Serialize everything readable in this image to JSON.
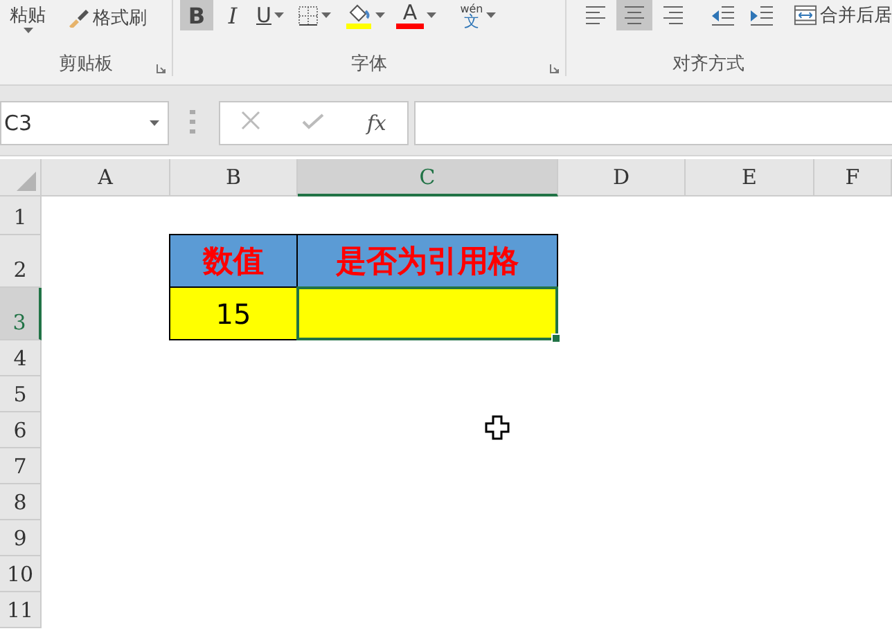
{
  "ribbon": {
    "groups": [
      {
        "label": "剪贴板",
        "launcher": true,
        "paste": {
          "label": "粘贴"
        },
        "format_painter": {
          "label": "格式刷"
        }
      },
      {
        "label": "字体",
        "launcher": true,
        "buttons": [
          {
            "kind": "bold",
            "text": "B",
            "selected": true
          },
          {
            "kind": "italic",
            "text": "I",
            "selected": false
          },
          {
            "kind": "underline",
            "text": "U",
            "selected": false,
            "dropdown": true
          },
          {
            "kind": "borders",
            "selected": false,
            "dropdown": true
          },
          {
            "kind": "fill",
            "selected": false,
            "dropdown": true,
            "color": "#ffff00"
          },
          {
            "kind": "fontcolor",
            "text": "A",
            "selected": false,
            "dropdown": true,
            "color": "#ff0000"
          },
          {
            "kind": "phonetic",
            "text": "wén",
            "glyph": "文",
            "selected": false,
            "dropdown": true
          }
        ]
      },
      {
        "label": "对齐方式",
        "buttons": [
          {
            "kind": "align-left",
            "selected": false
          },
          {
            "kind": "align-center",
            "selected": true
          },
          {
            "kind": "align-right",
            "selected": false
          },
          {
            "kind": "outdent",
            "selected": false
          },
          {
            "kind": "indent",
            "selected": false
          },
          {
            "kind": "merge",
            "text": "合并后居",
            "selected": false
          }
        ]
      }
    ]
  },
  "formula_bar": {
    "name_box": "C3",
    "fx": "fx"
  },
  "sheet": {
    "columns": [
      {
        "label": "A",
        "selected": false
      },
      {
        "label": "B",
        "selected": false
      },
      {
        "label": "C",
        "selected": true
      },
      {
        "label": "D",
        "selected": false
      },
      {
        "label": "E",
        "selected": false
      },
      {
        "label": "F",
        "selected": false
      }
    ],
    "rows": [
      {
        "label": "1",
        "selected": false
      },
      {
        "label": "2",
        "selected": false
      },
      {
        "label": "3",
        "selected": true
      },
      {
        "label": "4",
        "selected": false
      },
      {
        "label": "5",
        "selected": false
      },
      {
        "label": "6",
        "selected": false
      },
      {
        "label": "7",
        "selected": false
      },
      {
        "label": "8",
        "selected": false
      },
      {
        "label": "9",
        "selected": false
      },
      {
        "label": "10",
        "selected": false
      },
      {
        "label": "11",
        "selected": false
      }
    ],
    "table": [
      [
        {
          "kind": "header",
          "text": "数值",
          "selected": false
        },
        {
          "kind": "header",
          "text": "是否为引用格",
          "selected": false
        }
      ],
      [
        {
          "kind": "value",
          "text": "15",
          "selected": false
        },
        {
          "kind": "value",
          "selected": true
        }
      ]
    ]
  }
}
